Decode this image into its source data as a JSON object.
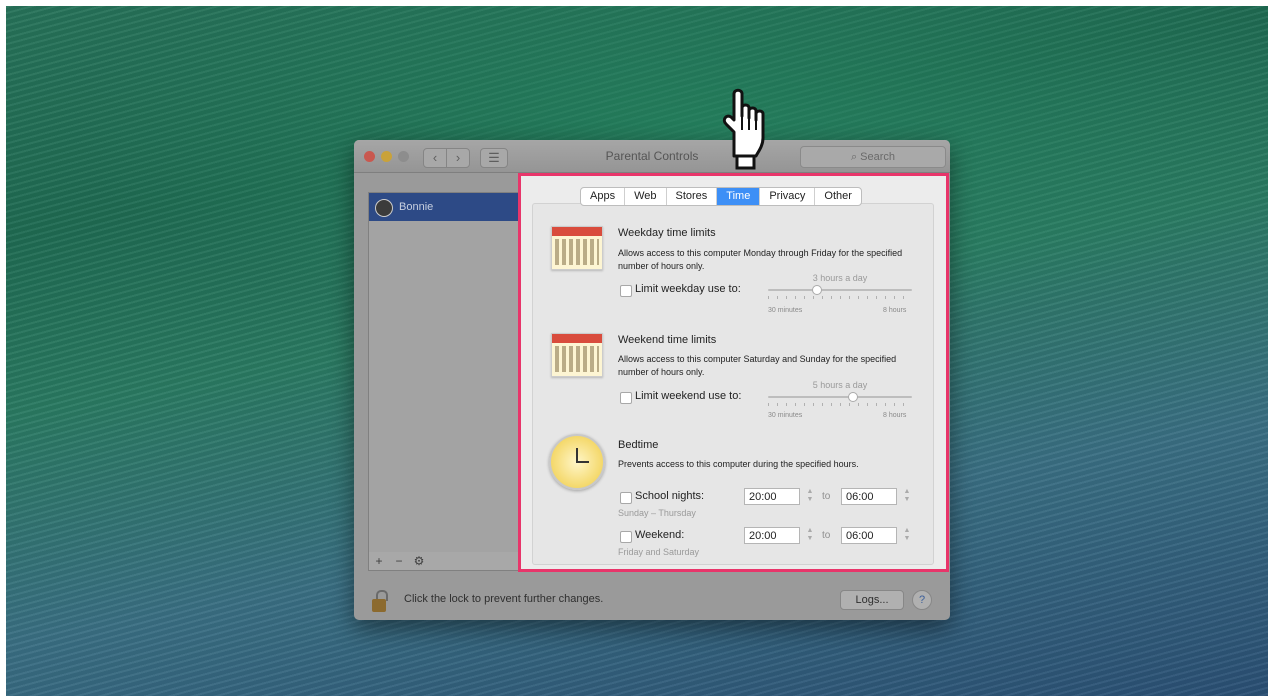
{
  "window": {
    "title": "Parental Controls",
    "search_placeholder": "Search",
    "nav_back": "‹",
    "nav_forward": "›",
    "grid_icon": "☰"
  },
  "sidebar": {
    "users": [
      {
        "name": "Bonnie"
      }
    ],
    "controls": {
      "add": "+",
      "remove": "−",
      "gear": "⚙"
    }
  },
  "tabs": [
    "Apps",
    "Web",
    "Stores",
    "Time",
    "Privacy",
    "Other"
  ],
  "active_tab": "Time",
  "weekday": {
    "title": "Weekday time limits",
    "desc": "Allows access to this computer Monday through Friday for the specified number of hours only.",
    "checkbox_label": "Limit weekday use to:",
    "slider_value": "3 hours a day",
    "slider_level": 0.33,
    "min_label": "30 minutes",
    "max_label": "8 hours"
  },
  "weekend": {
    "title": "Weekend time limits",
    "desc": "Allows access to this computer Saturday and Sunday for the specified number of hours only.",
    "checkbox_label": "Limit weekend use to:",
    "slider_value": "5 hours a day",
    "slider_level": 0.6,
    "min_label": "30 minutes",
    "max_label": "8 hours"
  },
  "bedtime": {
    "title": "Bedtime",
    "desc": "Prevents access to this computer during the specified hours.",
    "school": {
      "label": "School nights:",
      "caption": "Sunday – Thursday",
      "from": "20:00",
      "to": "06:00"
    },
    "weekend": {
      "label": "Weekend:",
      "caption": "Friday and Saturday",
      "from": "20:00",
      "to": "06:00"
    },
    "to_label": "to"
  },
  "bottom": {
    "lock_text": "Click the lock to prevent further changes.",
    "logs_label": "Logs...",
    "help_label": "?"
  },
  "colors": {
    "highlight": "#e8356a",
    "active_tab": "#3d8ff6",
    "selected_user": "#2d4a86"
  },
  "icons": [
    "calendar-icon",
    "clock-icon",
    "lock-icon",
    "hand-pointer-icon",
    "gear-icon",
    "search-icon"
  ]
}
